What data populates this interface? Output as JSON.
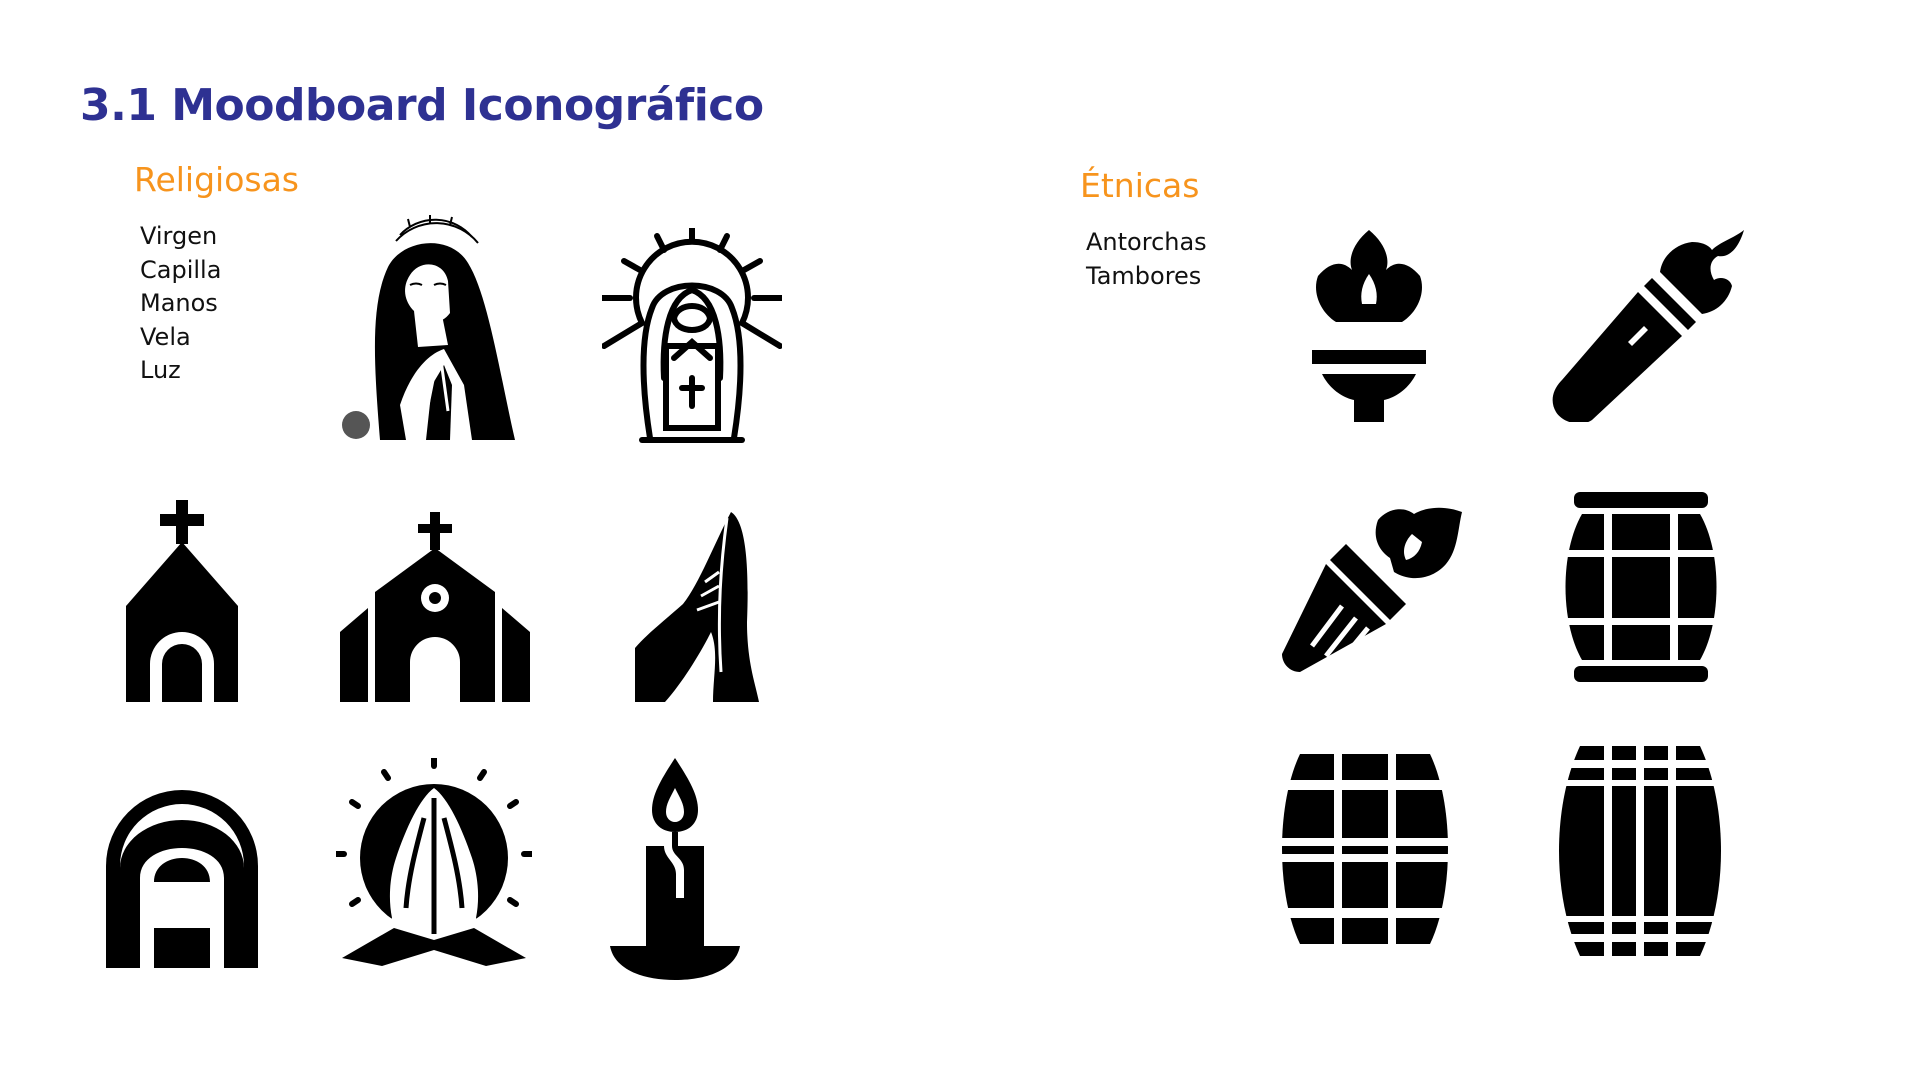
{
  "title": "3.1 Moodboard Iconográfico",
  "colors": {
    "title": "#2e3192",
    "section": "#f7941d",
    "text": "#111111",
    "icon": "#000000"
  },
  "religiosas": {
    "heading": "Religiosas",
    "items": [
      "Virgen",
      "Capilla",
      "Manos",
      "Vela",
      "Luz"
    ],
    "icons": [
      "virgin-praying-illustration",
      "virgin-halo-icon",
      "chapel-icon",
      "church-icon",
      "praying-hand-icon",
      "virgin-veil-icon",
      "praying-hands-halo-icon",
      "candle-icon"
    ]
  },
  "etnicas": {
    "heading": "Étnicas",
    "items": [
      "Antorchas",
      "Tambores"
    ],
    "icons": [
      "torch-upright-icon",
      "torch-diagonal-icon",
      "torch-tilted-icon",
      "drum-tall-icon",
      "drum-barrel-icon",
      "drum-barrel-ribbed-icon"
    ]
  }
}
